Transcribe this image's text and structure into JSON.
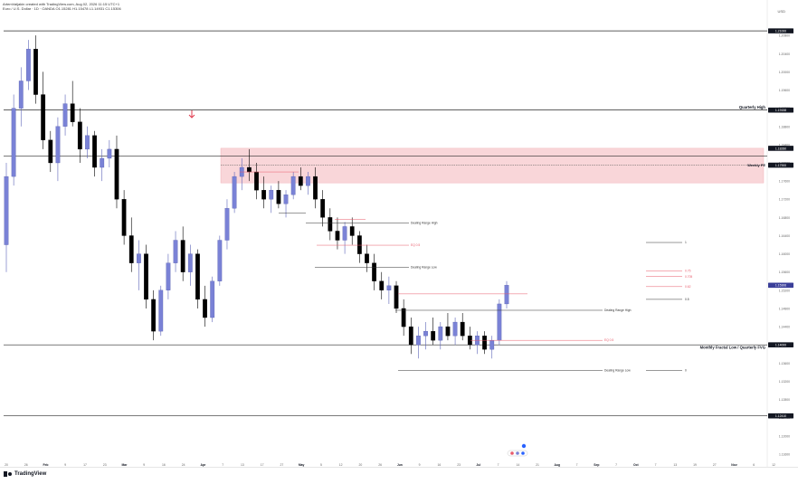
{
  "header": {
    "author_line": "ArtemValjakin created with TradingView.com, Aug 02, 2026 11:15 UTC+1",
    "symbol_line": "Euro / U.S. Dollar · 1D · OANDA  O1.15281  H1.15478  L1.14931  C1.15306"
  },
  "unit": "USD",
  "brand": {
    "name": "TradingView",
    "icon": "tradingview-logo-icon"
  },
  "colors": {
    "bull": "#7a82d6",
    "bear": "#000000",
    "zone": "#f9d6d9",
    "red_line": "#e85a6a",
    "level": "#2a2a2a"
  },
  "price_axis": {
    "ticks": [
      "1.20800",
      "1.20400",
      "1.20000",
      "1.19600",
      "1.19200",
      "1.18800",
      "1.18400",
      "1.18000",
      "1.17600",
      "1.17200",
      "1.16800",
      "1.16400",
      "1.16000",
      "1.15600",
      "1.15200",
      "1.14800",
      "1.14400",
      "1.14000",
      "1.13600",
      "1.13200",
      "1.12800",
      "1.12400",
      "1.12000",
      "1.11600"
    ],
    "tags": [
      "1.21000",
      "1.19158",
      "1.18280",
      "1.17900",
      "1.15306",
      "1.14000",
      "1.12410"
    ]
  },
  "time_axis": [
    "20",
    "26",
    "Feb",
    "9",
    "17",
    "23",
    "Mar",
    "9",
    "16",
    "24",
    "Apr",
    "7",
    "13",
    "17",
    "27",
    "May",
    "5",
    "12",
    "20",
    "26",
    "Jun",
    "9",
    "16",
    "23",
    "Jul",
    "7",
    "14",
    "21",
    "Aug",
    "7",
    "Sep",
    "7",
    "Oct",
    "7",
    "13",
    "19",
    "27",
    "Nov",
    "6",
    "12"
  ],
  "levels": {
    "quarterly_high": "Quarterly High",
    "weekly_fvg": "Weekly FE",
    "monthly_low": "Monthly Fractal Low / Quarterly FVG",
    "dealing_high_1": "Dealing Range High",
    "dealing_low_1": "Dealing Range Low",
    "eq_1": "EQ 0.5",
    "dealing_high_2": "Dealing Range High",
    "dealing_low_2": "Dealing Range Low",
    "eq_2": "EQ 0.5"
  },
  "fib": [
    "1",
    "0.75",
    "0.705",
    "0.62",
    "0.5",
    "0"
  ],
  "markers": {
    "arrow": "down-arrow-icon"
  },
  "chart_data": {
    "type": "candlestick",
    "symbol": "Euro / U.S. Dollar",
    "interval": "1D",
    "ylim": [
      1.114,
      1.213
    ],
    "horizontal_levels": [
      {
        "name": "Quarterly High",
        "price": 1.1916
      },
      {
        "name": "Weekly FE",
        "price": 1.1795
      },
      {
        "name": "Monthly Fractal Low / Quarterly FVG",
        "price": 1.14
      },
      {
        "name": "Dealing Range High",
        "price": 1.147
      },
      {
        "name": "Dealing Range Low",
        "price": 1.1344
      }
    ],
    "candles": [
      [
        1.162,
        1.18,
        1.156,
        1.177
      ],
      [
        1.177,
        1.195,
        1.175,
        1.192
      ],
      [
        1.192,
        1.201,
        1.188,
        1.198
      ],
      [
        1.198,
        1.207,
        1.196,
        1.205
      ],
      [
        1.205,
        1.208,
        1.193,
        1.195
      ],
      [
        1.195,
        1.2,
        1.183,
        1.185
      ],
      [
        1.185,
        1.187,
        1.178,
        1.18
      ],
      [
        1.18,
        1.19,
        1.176,
        1.188
      ],
      [
        1.188,
        1.195,
        1.186,
        1.193
      ],
      [
        1.193,
        1.198,
        1.188,
        1.189
      ],
      [
        1.189,
        1.192,
        1.18,
        1.183
      ],
      [
        1.183,
        1.188,
        1.181,
        1.186
      ],
      [
        1.186,
        1.187,
        1.177,
        1.179
      ],
      [
        1.179,
        1.183,
        1.176,
        1.181
      ],
      [
        1.181,
        1.185,
        1.179,
        1.183
      ],
      [
        1.183,
        1.186,
        1.17,
        1.172
      ],
      [
        1.172,
        1.174,
        1.162,
        1.164
      ],
      [
        1.164,
        1.168,
        1.156,
        1.158
      ],
      [
        1.158,
        1.163,
        1.152,
        1.16
      ],
      [
        1.16,
        1.162,
        1.148,
        1.15
      ],
      [
        1.15,
        1.152,
        1.141,
        1.143
      ],
      [
        1.143,
        1.153,
        1.142,
        1.152
      ],
      [
        1.152,
        1.16,
        1.15,
        1.158
      ],
      [
        1.158,
        1.165,
        1.156,
        1.163
      ],
      [
        1.163,
        1.166,
        1.154,
        1.156
      ],
      [
        1.156,
        1.162,
        1.153,
        1.16
      ],
      [
        1.16,
        1.161,
        1.148,
        1.15
      ],
      [
        1.15,
        1.153,
        1.144,
        1.146
      ],
      [
        1.146,
        1.155,
        1.145,
        1.154
      ],
      [
        1.154,
        1.164,
        1.153,
        1.163
      ],
      [
        1.163,
        1.172,
        1.161,
        1.17
      ],
      [
        1.17,
        1.178,
        1.169,
        1.177
      ],
      [
        1.177,
        1.181,
        1.174,
        1.179
      ],
      [
        1.179,
        1.183,
        1.176,
        1.178
      ],
      [
        1.178,
        1.18,
        1.172,
        1.174
      ],
      [
        1.174,
        1.177,
        1.17,
        1.172
      ],
      [
        1.172,
        1.175,
        1.169,
        1.174
      ],
      [
        1.174,
        1.176,
        1.17,
        1.171
      ],
      [
        1.171,
        1.174,
        1.168,
        1.173
      ],
      [
        1.173,
        1.178,
        1.172,
        1.177
      ],
      [
        1.177,
        1.179,
        1.174,
        1.175
      ],
      [
        1.175,
        1.178,
        1.173,
        1.177
      ],
      [
        1.177,
        1.179,
        1.17,
        1.172
      ],
      [
        1.172,
        1.174,
        1.166,
        1.168
      ],
      [
        1.168,
        1.17,
        1.163,
        1.165
      ],
      [
        1.165,
        1.168,
        1.161,
        1.163
      ],
      [
        1.163,
        1.167,
        1.16,
        1.166
      ],
      [
        1.166,
        1.168,
        1.162,
        1.164
      ],
      [
        1.164,
        1.165,
        1.158,
        1.16
      ],
      [
        1.16,
        1.162,
        1.156,
        1.158
      ],
      [
        1.158,
        1.16,
        1.152,
        1.154
      ],
      [
        1.154,
        1.156,
        1.15,
        1.152
      ],
      [
        1.152,
        1.155,
        1.149,
        1.153
      ],
      [
        1.153,
        1.154,
        1.147,
        1.148
      ],
      [
        1.148,
        1.15,
        1.142,
        1.144
      ],
      [
        1.144,
        1.146,
        1.138,
        1.14
      ],
      [
        1.14,
        1.144,
        1.137,
        1.142
      ],
      [
        1.142,
        1.145,
        1.139,
        1.143
      ],
      [
        1.143,
        1.146,
        1.14,
        1.141
      ],
      [
        1.141,
        1.145,
        1.139,
        1.144
      ],
      [
        1.144,
        1.147,
        1.141,
        1.142
      ],
      [
        1.142,
        1.146,
        1.14,
        1.145
      ],
      [
        1.145,
        1.147,
        1.141,
        1.142
      ],
      [
        1.142,
        1.144,
        1.139,
        1.14
      ],
      [
        1.14,
        1.143,
        1.138,
        1.142
      ],
      [
        1.142,
        1.143,
        1.138,
        1.139
      ],
      [
        1.139,
        1.142,
        1.137,
        1.141
      ],
      [
        1.141,
        1.15,
        1.14,
        1.149
      ],
      [
        1.149,
        1.154,
        1.148,
        1.1531
      ]
    ]
  }
}
